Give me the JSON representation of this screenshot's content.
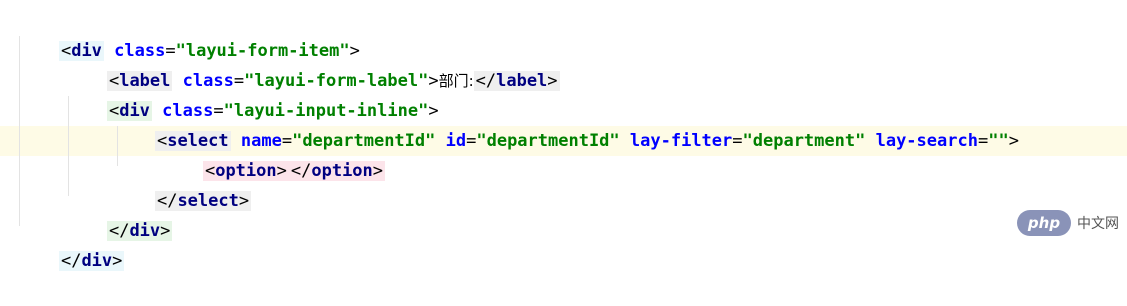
{
  "code": {
    "lines": [
      {
        "open": "<",
        "tag": "div",
        "attrs": [
          {
            "name": "class",
            "value": "\"layui-form-item\""
          }
        ],
        "close": ">"
      },
      {
        "open": "<",
        "tag": "label",
        "attrs": [
          {
            "name": "class",
            "value": "\"layui-form-label\""
          }
        ],
        "close": ">",
        "text": "部门:",
        "end_open": "</",
        "end_tag": "label",
        "end_close": ">"
      },
      {
        "open": "<",
        "tag": "div",
        "attrs": [
          {
            "name": "class",
            "value": "\"layui-input-inline\""
          }
        ],
        "close": ">"
      },
      {
        "open": "<",
        "tag": "select",
        "attrs": [
          {
            "name": "name",
            "value": "\"departmentId\""
          },
          {
            "name": "id",
            "value": "\"departmentId\""
          },
          {
            "name": "lay-filter",
            "value": "\"department\""
          },
          {
            "name": "lay-search",
            "value": "\"\""
          }
        ],
        "close": ">"
      },
      {
        "open": "<",
        "tag": "option",
        "close": ">",
        "end_open": "</",
        "end_tag": "option",
        "end_close": ">"
      },
      {
        "open": "</",
        "tag": "select",
        "close": ">"
      },
      {
        "open": "</",
        "tag": "div",
        "close": ">"
      },
      {
        "open": "</",
        "tag": "div",
        "close": ">"
      }
    ]
  },
  "watermark": {
    "logo": "php",
    "text": "中文网"
  }
}
